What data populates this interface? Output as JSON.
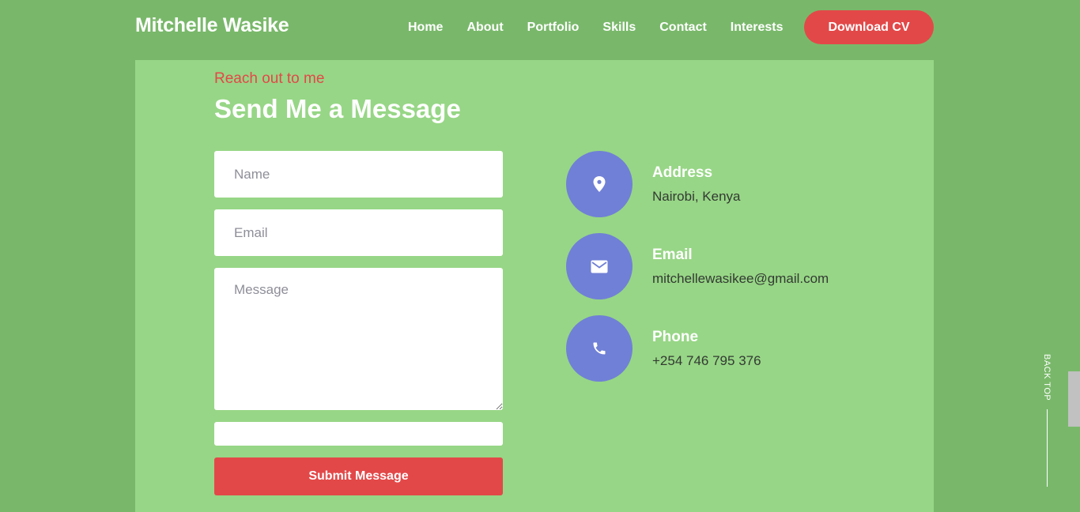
{
  "header": {
    "brand": "Mitchelle Wasike",
    "nav": [
      "Home",
      "About",
      "Portfolio",
      "Skills",
      "Contact",
      "Interests"
    ],
    "cta": "Download CV"
  },
  "contact": {
    "eyebrow": "Reach out to me",
    "title": "Send Me a Message",
    "form": {
      "name_placeholder": "Name",
      "email_placeholder": "Email",
      "message_placeholder": "Message",
      "submit_label": "Submit Message"
    },
    "info": [
      {
        "icon": "location-pin-icon",
        "label": "Address",
        "value": "Nairobi, Kenya"
      },
      {
        "icon": "envelope-icon",
        "label": "Email",
        "value": "mitchellewasikee@gmail.com"
      },
      {
        "icon": "phone-icon",
        "label": "Phone",
        "value": "+254 746 795 376"
      }
    ]
  },
  "back_top": "BACK TOP",
  "colors": {
    "page_bg": "#79b86a",
    "panel_bg": "#97d686",
    "accent_red": "#e34848",
    "icon_circle": "#7080d6"
  }
}
